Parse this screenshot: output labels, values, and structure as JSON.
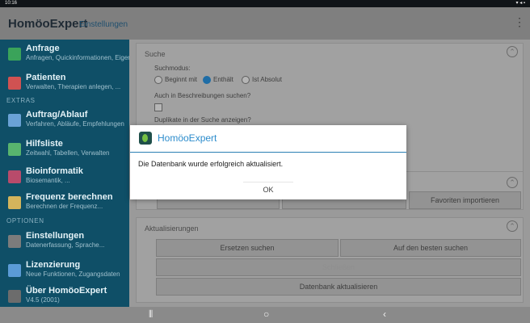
{
  "statusbar": {
    "time": "10:16",
    "right_icons": "▾ ◂ ▪"
  },
  "appbar": {
    "brand": "HomöoExpert",
    "subtitle": "Einstellungen"
  },
  "sidebar": {
    "items": [
      {
        "label": "Anfrage",
        "sub": "Anfragen, Quickinformationen, Eigen...",
        "icon_color": "#3aa35a",
        "icon": "note-icon"
      },
      {
        "label": "Patienten",
        "sub": "Verwalten, Therapien anlegen, ...",
        "icon_color": "#d05252",
        "icon": "person-icon"
      },
      {
        "label": "Auftrag/Ablauf",
        "sub": "Verfahren, Abläufe, Empfehlungen",
        "icon_color": "#6aa2d6",
        "icon": "flow-icon"
      },
      {
        "label": "Hilfsliste",
        "sub": "Zeitwahl, Tabellen, Verwalten",
        "icon_color": "#58b46e",
        "icon": "list-icon"
      },
      {
        "label": "Bioinformatik",
        "sub": "Biosemantik, ...",
        "icon_color": "#b84b6b",
        "icon": "dna-icon"
      },
      {
        "label": "Frequenz berechnen",
        "sub": "Berechnen der Frequenz...",
        "icon_color": "#d3b45c",
        "icon": "wave-icon"
      },
      {
        "label": "Einstellungen",
        "sub": "Datenerfassung, Sprache...",
        "icon_color": "#7c7c7c",
        "icon": "gear-icon"
      },
      {
        "label": "Lizenzierung",
        "sub": "Neue Funktionen, Zugangsdaten",
        "icon_color": "#5b9bd6",
        "icon": "key-icon"
      },
      {
        "label": "Über HomöoExpert",
        "sub": "V4.5 (2001)",
        "icon_color": "#6c6c6c",
        "icon": "info-icon"
      }
    ],
    "sections": [
      "EXTRAS",
      "OPTIONEN"
    ]
  },
  "content": {
    "card1": {
      "title": "Suche",
      "searchmode_label": "Suchmodus:",
      "options": [
        "Beginnt mit",
        "Enthält",
        "Ist Absolut"
      ],
      "selected_index": 1,
      "also_descriptions": "Auch in Beschreibungen suchen?",
      "duplicates": "Duplikate in der Suche anzeigen?"
    },
    "card2": {
      "button": "Favoriten importieren"
    },
    "card3": {
      "title": "Aktualisierungen",
      "buttons": [
        "Ersetzen suchen",
        "Auf den besten suchen",
        "Schließen",
        "Datenbank aktualisieren"
      ]
    }
  },
  "dialog": {
    "title": "HomöoExpert",
    "message": "Die Datenbank wurde erfolgreich aktualisiert.",
    "ok": "OK"
  },
  "navbar": {
    "recents": "⦀",
    "home": "○",
    "back": "‹"
  }
}
